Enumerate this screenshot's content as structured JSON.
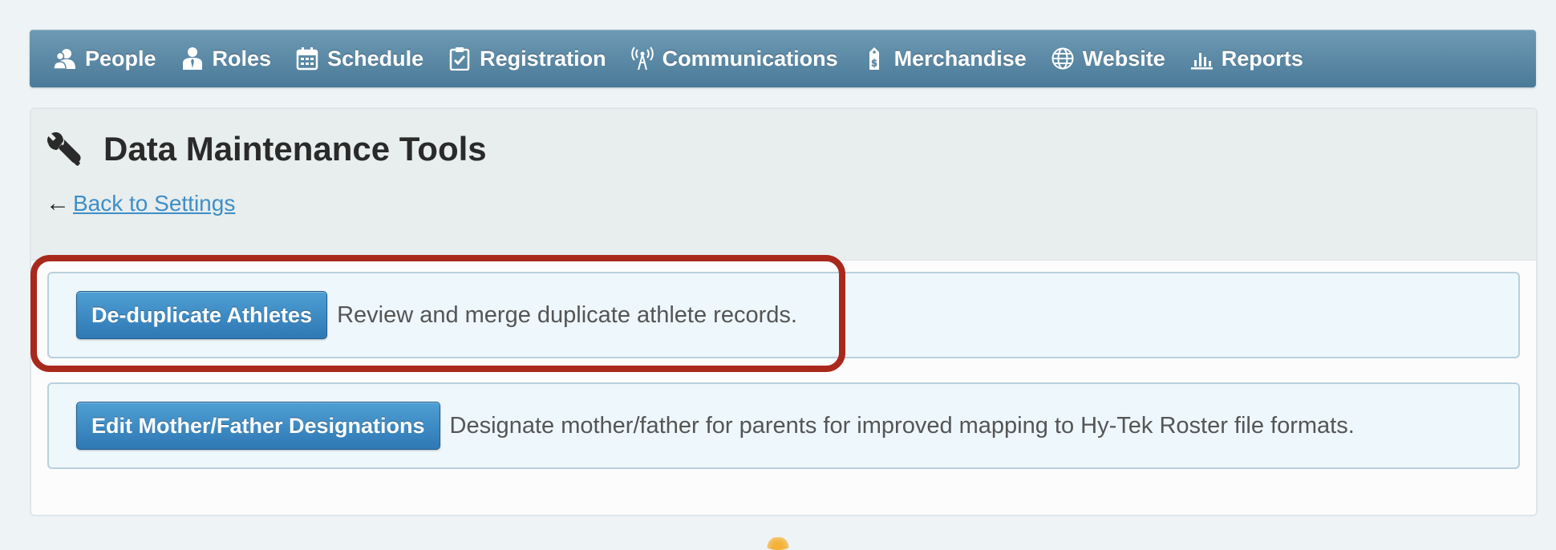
{
  "nav": {
    "items": [
      {
        "label": "People",
        "icon": "people-icon"
      },
      {
        "label": "Roles",
        "icon": "user-tie-icon"
      },
      {
        "label": "Schedule",
        "icon": "calendar-icon"
      },
      {
        "label": "Registration",
        "icon": "clipboard-check-icon"
      },
      {
        "label": "Communications",
        "icon": "broadcast-tower-icon"
      },
      {
        "label": "Merchandise",
        "icon": "price-tag-icon"
      },
      {
        "label": "Website",
        "icon": "globe-icon"
      },
      {
        "label": "Reports",
        "icon": "bar-chart-icon"
      }
    ]
  },
  "page": {
    "title": "Data Maintenance Tools",
    "title_icon": "wrench-icon",
    "back_arrow": "←",
    "back_link": "Back to Settings"
  },
  "tools": [
    {
      "button": "De-duplicate Athletes",
      "description": "Review and merge duplicate athlete records."
    },
    {
      "button": "Edit Mother/Father Designations",
      "description": "Designate mother/father for parents for improved mapping to Hy-Tek Roster file formats."
    }
  ],
  "colors": {
    "navbar": "#5a88a6",
    "button": "#3a87c2",
    "link": "#3d8fc9",
    "highlight": "#a9281c"
  }
}
